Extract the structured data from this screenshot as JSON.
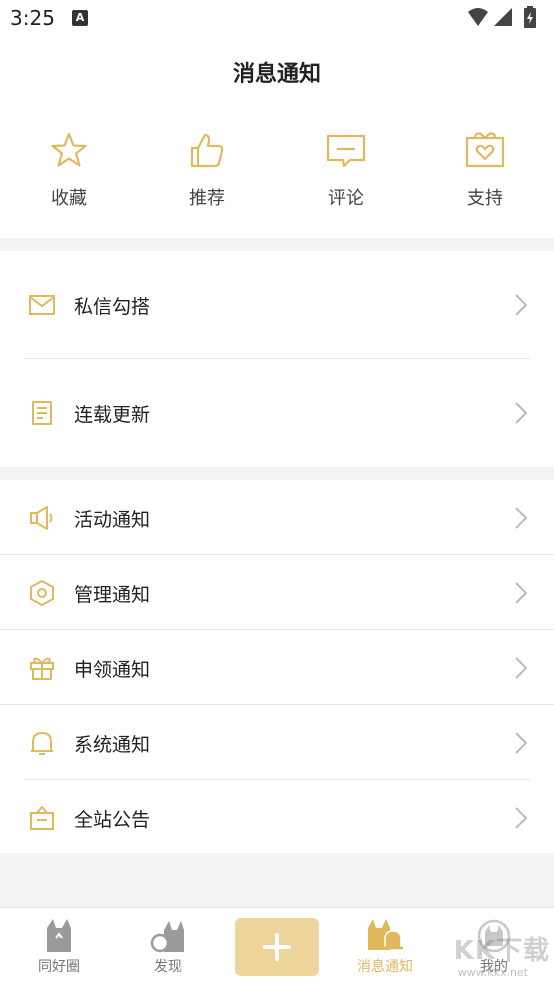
{
  "status_bar": {
    "time": "3:25",
    "notif_badge": "A"
  },
  "header": {
    "title": "消息通知"
  },
  "quick_actions": [
    {
      "label": "收藏",
      "icon": "star-icon"
    },
    {
      "label": "推荐",
      "icon": "thumbs-up-icon"
    },
    {
      "label": "评论",
      "icon": "comment-icon"
    },
    {
      "label": "支持",
      "icon": "gift-heart-icon"
    }
  ],
  "group1": [
    {
      "label": "私信勾搭",
      "icon": "mail-icon"
    },
    {
      "label": "连载更新",
      "icon": "document-icon"
    }
  ],
  "group2": [
    {
      "label": "活动通知",
      "icon": "speaker-icon"
    },
    {
      "label": "管理通知",
      "icon": "hexagon-icon"
    },
    {
      "label": "申领通知",
      "icon": "gift-icon"
    },
    {
      "label": "系统通知",
      "icon": "bell-icon"
    },
    {
      "label": "全站公告",
      "icon": "briefcase-icon"
    }
  ],
  "tabbar": {
    "tabs": [
      {
        "label": "同好圈",
        "icon": "cat-icon"
      },
      {
        "label": "发现",
        "icon": "cat-magnifier-icon"
      },
      {
        "label": "消息通知",
        "icon": "cat-bell-icon",
        "active": true
      },
      {
        "label": "我的",
        "icon": "cat-profile-icon"
      }
    ],
    "watermark": "KK下载",
    "watermark_sub": "www.kkx.net"
  },
  "colors": {
    "accent": "#e0b85e",
    "plus_button": "#edd59b"
  }
}
